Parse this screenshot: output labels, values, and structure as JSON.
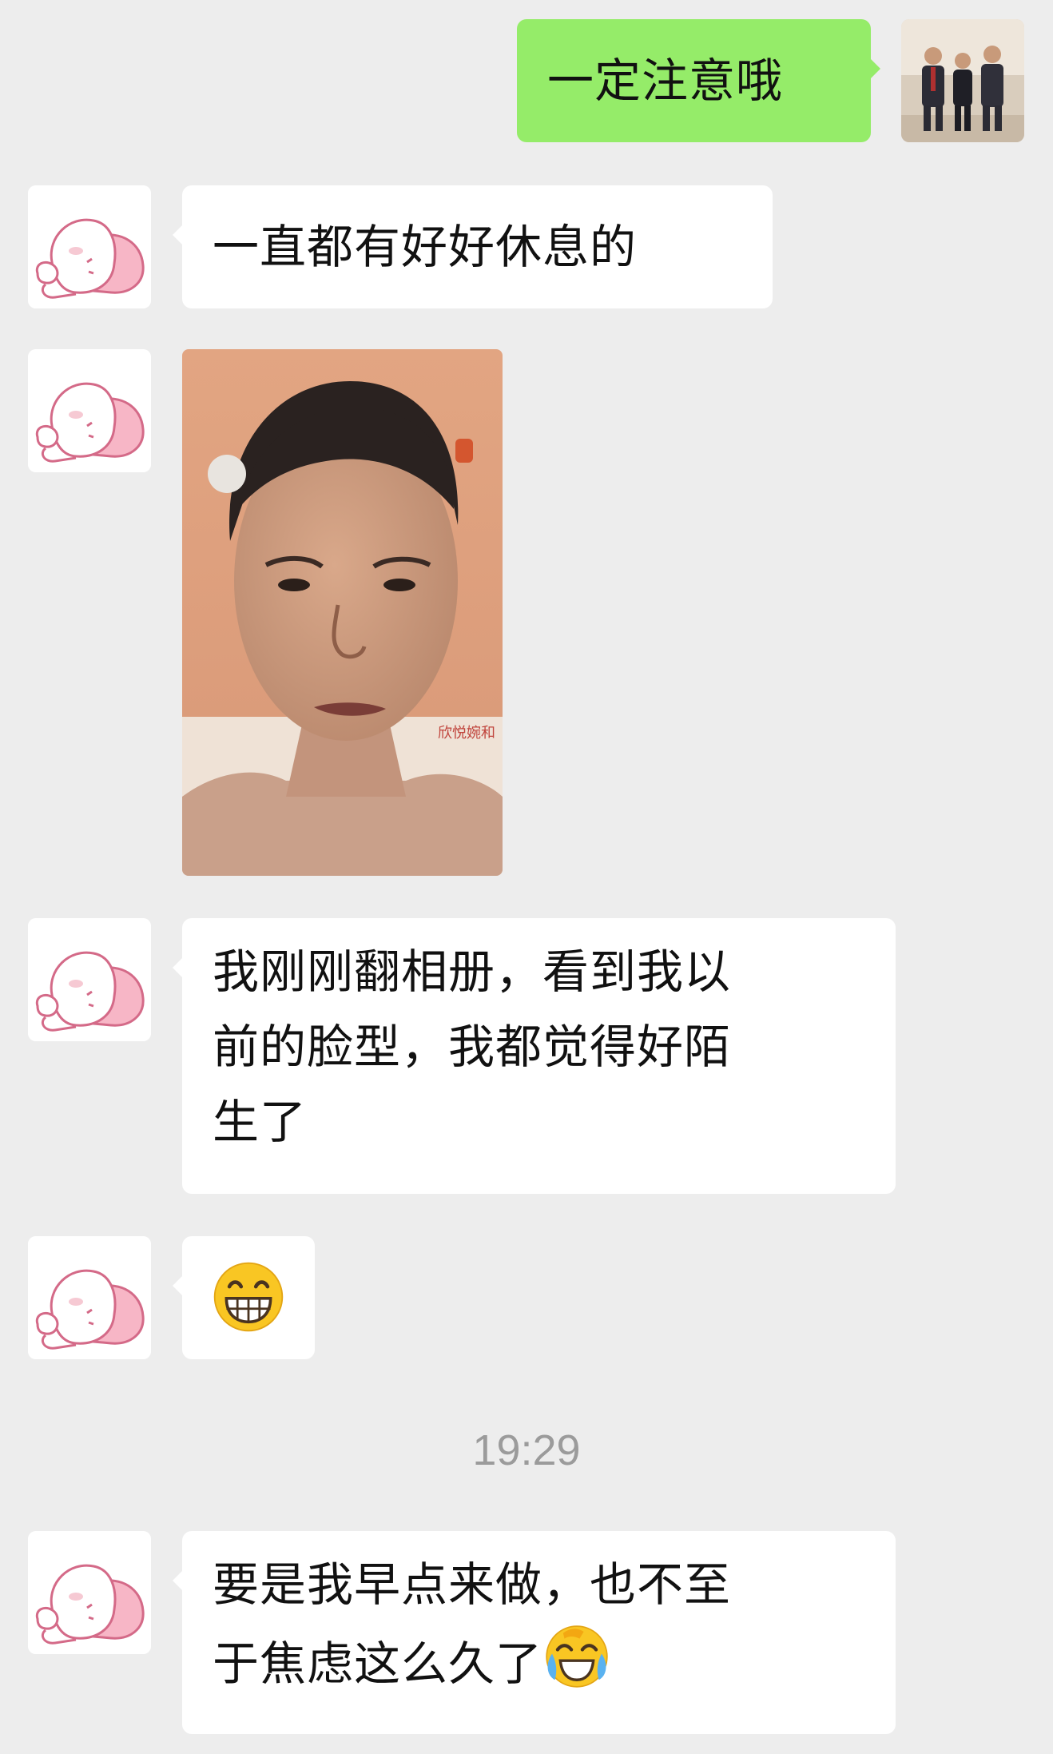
{
  "messages": [
    {
      "id": 1,
      "side": "right",
      "type": "text",
      "text": "一定注意哦"
    },
    {
      "id": 2,
      "side": "left",
      "type": "text",
      "text": "一直都有好好休息的"
    },
    {
      "id": 3,
      "side": "left",
      "type": "image",
      "image": "selfie-photo"
    },
    {
      "id": 4,
      "side": "left",
      "type": "text",
      "lines": [
        "我刚刚翻相册，看到我以",
        "前的脸型，我都觉得好陌",
        "生了"
      ]
    },
    {
      "id": 5,
      "side": "left",
      "type": "emoji",
      "emoji": "grinning-face-emoji"
    },
    {
      "id": 6,
      "side": "left",
      "type": "text",
      "lines": [
        "要是我早点来做，也不至",
        "于焦虑这么久了"
      ],
      "trailing_emoji": "face-with-tears-of-joy-emoji"
    }
  ],
  "timestamp": "19:29",
  "colors": {
    "background": "#ededed",
    "incoming_bubble": "#ffffff",
    "outgoing_bubble": "#95ec69",
    "timestamp_text": "#9b9b9b"
  },
  "icons": {
    "contact_avatar": "sleeping-cartoon-avatar",
    "self_avatar": "group-photo-avatar"
  }
}
